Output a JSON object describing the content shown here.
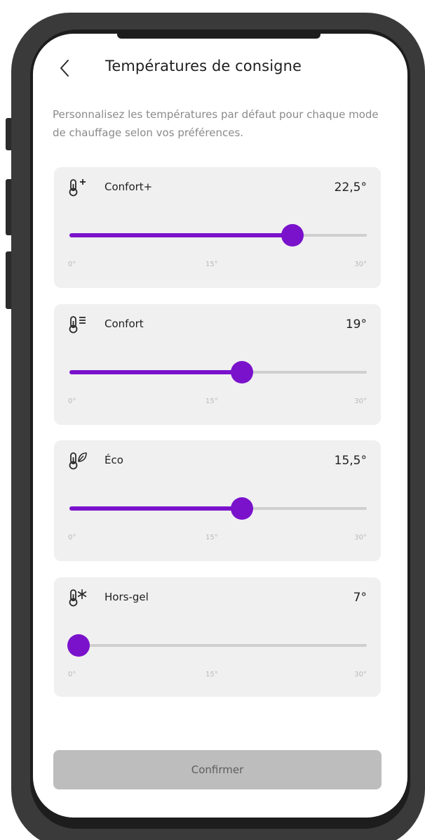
{
  "header": {
    "title": "Températures de consigne",
    "back_icon": "chevron-left-icon"
  },
  "description": "Personnalisez les températures par défaut pour chaque mode de chauffage selon vos préférences.",
  "accent_color": "#7a12cc",
  "modes": [
    {
      "icon": "thermometer-plus-icon",
      "label": "Confort+",
      "value_text": "22,5°",
      "value": 22.5,
      "tick_min": "0°",
      "tick_mid": "15°",
      "tick_max": "30°"
    },
    {
      "icon": "thermometer-lines-icon",
      "label": "Confort",
      "value_text": "19°",
      "value": 19,
      "tick_min": "0°",
      "tick_mid": "15°",
      "tick_max": "30°"
    },
    {
      "icon": "thermometer-leaf-icon",
      "label": "Éco",
      "value_text": "15,5°",
      "value": 15.5,
      "tick_min": "0°",
      "tick_mid": "15°",
      "tick_max": "30°"
    },
    {
      "icon": "thermometer-snowflake-icon",
      "label": "Hors-gel",
      "value_text": "7°",
      "value": 7,
      "tick_min": "0°",
      "tick_mid": "15°",
      "tick_max": "30°"
    }
  ],
  "slider_levels": [
    0.75,
    0.58,
    0.58,
    0.03
  ],
  "confirm_label": "Confirmer"
}
